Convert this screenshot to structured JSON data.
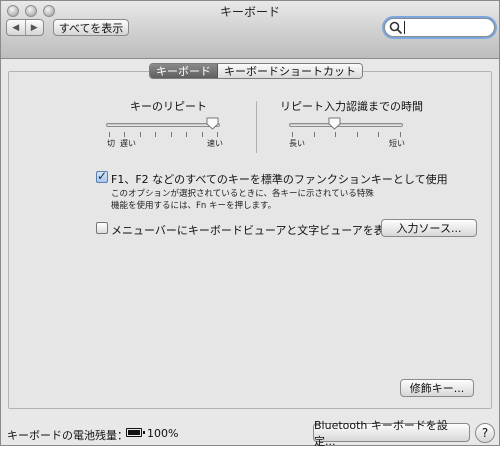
{
  "window": {
    "title": "キーボード"
  },
  "toolbar": {
    "back_glyph": "◀",
    "forward_glyph": "▶",
    "show_all_label": "すべてを表示",
    "search_placeholder": ""
  },
  "tabs": [
    {
      "label": "キーボード",
      "active": true
    },
    {
      "label": "キーボードショートカット",
      "active": false
    }
  ],
  "key_repeat": {
    "title": "キーのリピート",
    "min_label": "切",
    "slow_label": "遅い",
    "fast_label": "速い",
    "tick_count": 8,
    "value_fraction": 0.93
  },
  "delay_until_repeat": {
    "title": "リピート入力認識までの時間",
    "long_label": "長い",
    "short_label": "短い",
    "tick_count": 6,
    "value_fraction": 0.4
  },
  "fn_keys": {
    "checked": true,
    "label": "F1、F2 などのすべてのキーを標準のファンクションキーとして使用",
    "desc_line1": "このオプションが選択されているときに、各キーに示されている特殊",
    "desc_line2": "機能を使用するには、Fn キーを押します。"
  },
  "menubar_viewer": {
    "checked": false,
    "label": "メニューバーにキーボードビューアと文字ビューアを表示"
  },
  "buttons": {
    "input_sources": "入力ソース...",
    "modifier_keys": "修飾キー...",
    "bluetooth_setup": "Bluetooth キーボードを設定...",
    "help": "?"
  },
  "battery": {
    "label": "キーボードの電池残量：",
    "percent": "100%",
    "level_fraction": 1.0
  },
  "icons": [
    "search-icon",
    "battery-icon",
    "help-icon",
    "checkmark-icon"
  ]
}
